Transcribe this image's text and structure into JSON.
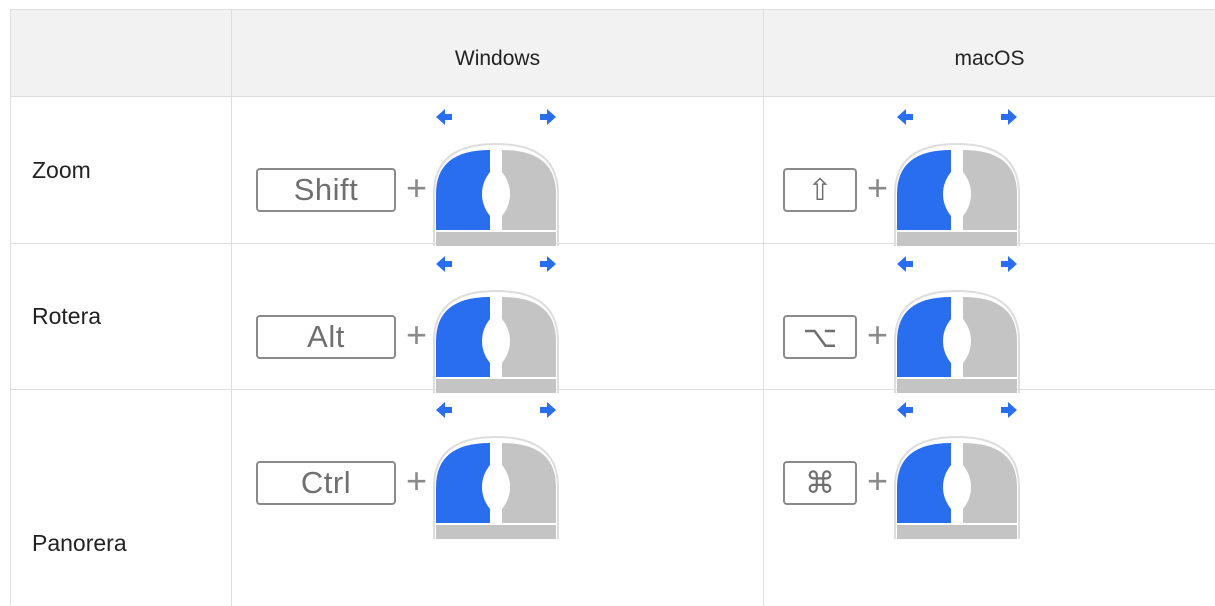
{
  "header": {
    "empty": "",
    "windows": "Windows",
    "macos": "macOS"
  },
  "rows": [
    {
      "action": "Zoom",
      "windows_key": "Shift",
      "mac_key": "⇧"
    },
    {
      "action": "Rotera",
      "windows_key": "Alt",
      "mac_key": "⌥"
    },
    {
      "action": "Panorera",
      "windows_key": "Ctrl",
      "mac_key": "⌘"
    }
  ],
  "plus_sign": "+",
  "colors": {
    "accent": "#2a6ef0",
    "mouse_gray": "#c4c4c4",
    "key_gray": "#8a8a8a",
    "header_bg": "#f2f2f2",
    "border": "#dddddd"
  },
  "icons": {
    "mouse": "mouse-left-button-drag-icon",
    "arrow_left": "arrow-left-icon",
    "arrow_right": "arrow-right-icon"
  }
}
